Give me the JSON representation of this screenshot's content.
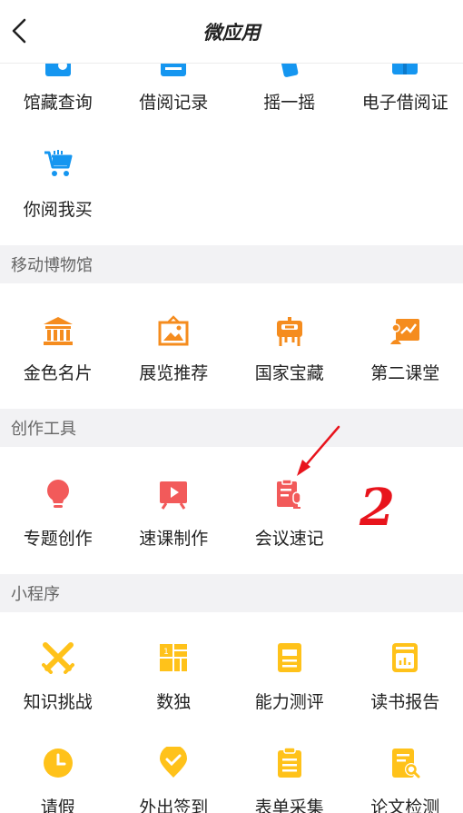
{
  "header": {
    "title": "微应用"
  },
  "row1": [
    {
      "label": "馆藏查询",
      "icon": "catalog-search-icon"
    },
    {
      "label": "借阅记录",
      "icon": "borrow-record-icon"
    },
    {
      "label": "摇一摇",
      "icon": "shake-icon"
    },
    {
      "label": "电子借阅证",
      "icon": "e-library-card-icon"
    }
  ],
  "row2": [
    {
      "label": "你阅我买",
      "icon": "shopping-cart-icon"
    }
  ],
  "sections": {
    "museum": "移动博物馆",
    "tools": "创作工具",
    "miniapps": "小程序"
  },
  "museum_items": [
    {
      "label": "金色名片",
      "icon": "museum-building-icon"
    },
    {
      "label": "展览推荐",
      "icon": "exhibition-frame-icon"
    },
    {
      "label": "国家宝藏",
      "icon": "national-treasure-icon"
    },
    {
      "label": "第二课堂",
      "icon": "second-classroom-icon"
    }
  ],
  "tool_items": [
    {
      "label": "专题创作",
      "icon": "lightbulb-icon"
    },
    {
      "label": "速课制作",
      "icon": "video-play-icon"
    },
    {
      "label": "会议速记",
      "icon": "meeting-notes-icon"
    }
  ],
  "mini_row1": [
    {
      "label": "知识挑战",
      "icon": "crossed-swords-icon"
    },
    {
      "label": "数独",
      "icon": "sudoku-grid-icon"
    },
    {
      "label": "能力测评",
      "icon": "assessment-document-icon"
    },
    {
      "label": "读书报告",
      "icon": "book-report-icon"
    }
  ],
  "mini_row2": [
    {
      "label": "请假",
      "icon": "clock-icon"
    },
    {
      "label": "外出签到",
      "icon": "location-checkin-icon"
    },
    {
      "label": "表单采集",
      "icon": "clipboard-form-icon"
    },
    {
      "label": "论文检测",
      "icon": "paper-check-icon"
    }
  ],
  "annotation": {
    "text": "2",
    "color": "#e8141c"
  },
  "colors": {
    "blue": "#1596f0",
    "orange": "#f58c1e",
    "red": "#f25a5a",
    "yellow": "#ffc21a"
  }
}
